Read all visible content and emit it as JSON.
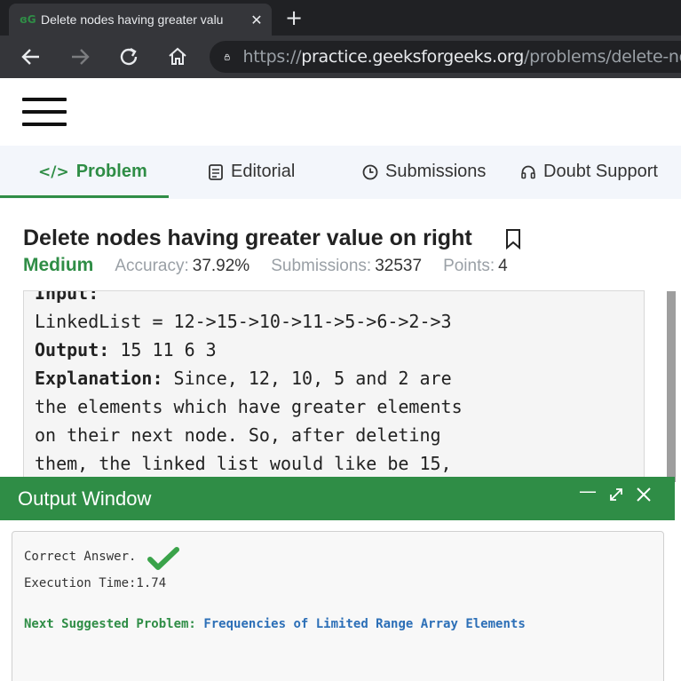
{
  "browser": {
    "tab_title": "Delete nodes having greater valu",
    "tab_favicon": "ɞG",
    "url_protocol": "https://",
    "url_host": "practice.geeksforgeeks.org",
    "url_path": "/problems/delete-no"
  },
  "problem_tabs": [
    {
      "label": "Problem",
      "icon": "</>",
      "active": true
    },
    {
      "label": "Editorial",
      "icon": "editorial-icon"
    },
    {
      "label": "Submissions",
      "icon": "clock-icon"
    },
    {
      "label": "Doubt Support",
      "icon": "headset-icon"
    }
  ],
  "problem": {
    "title": "Delete nodes having greater value on right",
    "difficulty": "Medium",
    "accuracy_label": "Accuracy:",
    "accuracy_value": "37.92%",
    "submissions_label": "Submissions:",
    "submissions_value": "32537",
    "points_label": "Points:",
    "points_value": "4"
  },
  "example": {
    "input_label": "Input:",
    "input_value": "LinkedList = 12->15->10->11->5->6->2->3",
    "output_label": "Output:",
    "output_value": " 15 11 6 3",
    "explanation_label": "Explanation:",
    "explanation_lines": [
      " Since, 12, 10, 5 and 2 are",
      "the elements which have greater elements",
      "on their next node. So, after deleting",
      "them, the linked list would like be 15,"
    ]
  },
  "output_window": {
    "title": "Output Window",
    "result": "Correct Answer.",
    "execution_time": "Execution Time:1.74",
    "suggest_label": "Next Suggested Problem:",
    "suggest_link": "Frequencies of Limited Range Array Elements"
  },
  "colors": {
    "brand_green": "#2f8d46",
    "link_blue": "#2c6fb7"
  }
}
